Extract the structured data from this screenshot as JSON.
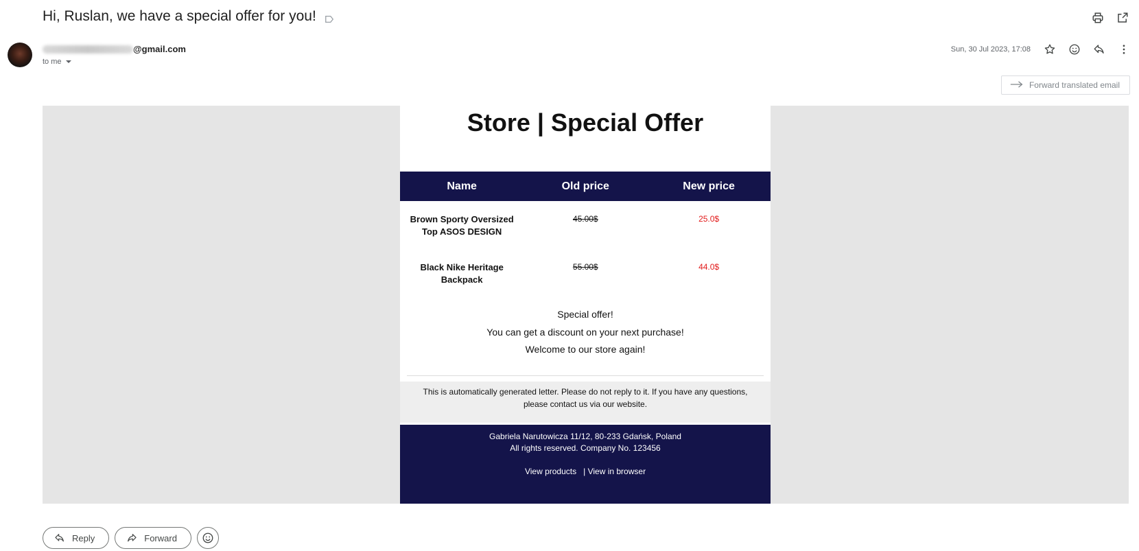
{
  "email": {
    "subject": "Hi, Ruslan, we have a special offer for you!",
    "sender_domain": "@gmail.com",
    "recipient": "to me",
    "date": "Sun, 30 Jul 2023, 17:08",
    "forward_translated_label": "Forward translated email"
  },
  "icons": {
    "label": "label-icon",
    "print": "print-icon",
    "open_new_window": "open-in-new-window-icon",
    "star": "star-icon",
    "emoji": "emoji-icon",
    "reply": "reply-icon",
    "more": "more-vert-icon",
    "arrow_right": "arrow-right-icon",
    "forward": "forward-icon"
  },
  "mail_body": {
    "title": "Store | Special Offer",
    "table": {
      "headers": [
        "Name",
        "Old price",
        "New price"
      ],
      "rows": [
        {
          "name_line1": "Brown Sporty Oversized",
          "name_line2": "Top ASOS DESIGN",
          "old_price": "45.00$",
          "new_price": "25.0$"
        },
        {
          "name_line1": "Black Nike Heritage",
          "name_line2": "Backpack",
          "old_price": "55.00$",
          "new_price": "44.0$"
        }
      ]
    },
    "promo": [
      "Special offer!",
      "You can get a discount on your next purchase!",
      "Welcome to our store again!"
    ],
    "notice_line1": "This is automatically generated letter. Please do not reply to it. If you have any questions,",
    "notice_line2": "please contact us via our website.",
    "footer": {
      "address": "Gabriela Narutowicza 11/12, 80-233 Gdańsk, Poland",
      "rights": "All rights reserved.  Company No. 123456",
      "link_products": "View products",
      "separator": "|",
      "link_browser": "View in browser"
    }
  },
  "actions": {
    "reply_label": "Reply",
    "forward_label": "Forward"
  },
  "colors": {
    "brand_navy": "#14144a",
    "sale_red": "#e21a1a",
    "outer_bg": "#e5e5e5"
  }
}
